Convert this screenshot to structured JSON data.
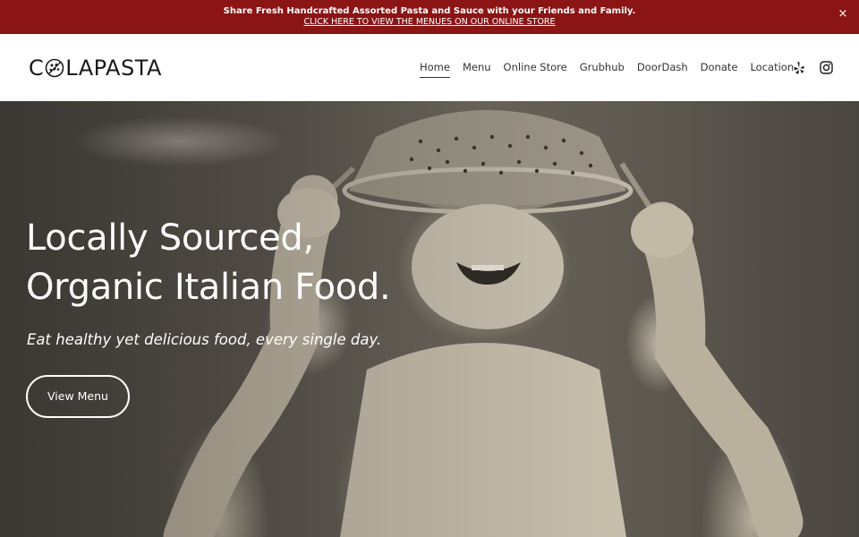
{
  "announcement": {
    "message": "Share Fresh Handcrafted Assorted Pasta and Sauce with your Friends and Family.",
    "link": "CLICK HERE TO VIEW THE MENUES ON OUR ONLINE STORE",
    "close_label": "×",
    "background": "#8b1414"
  },
  "header": {
    "logo_left": "C",
    "logo_right": "LAPASTA",
    "nav": [
      {
        "label": "Home",
        "active": true
      },
      {
        "label": "Menu"
      },
      {
        "label": "Online Store"
      },
      {
        "label": "Grubhub"
      },
      {
        "label": "DoorDash"
      },
      {
        "label": "Donate"
      },
      {
        "label": "Location"
      }
    ],
    "social_icons": [
      "yelp-icon",
      "instagram-icon"
    ]
  },
  "hero": {
    "title_line1": "Locally Sourced,",
    "title_line2": "Organic Italian Food.",
    "subtitle": "Eat healthy yet delicious food, every single day.",
    "cta_label": "View Menu"
  }
}
